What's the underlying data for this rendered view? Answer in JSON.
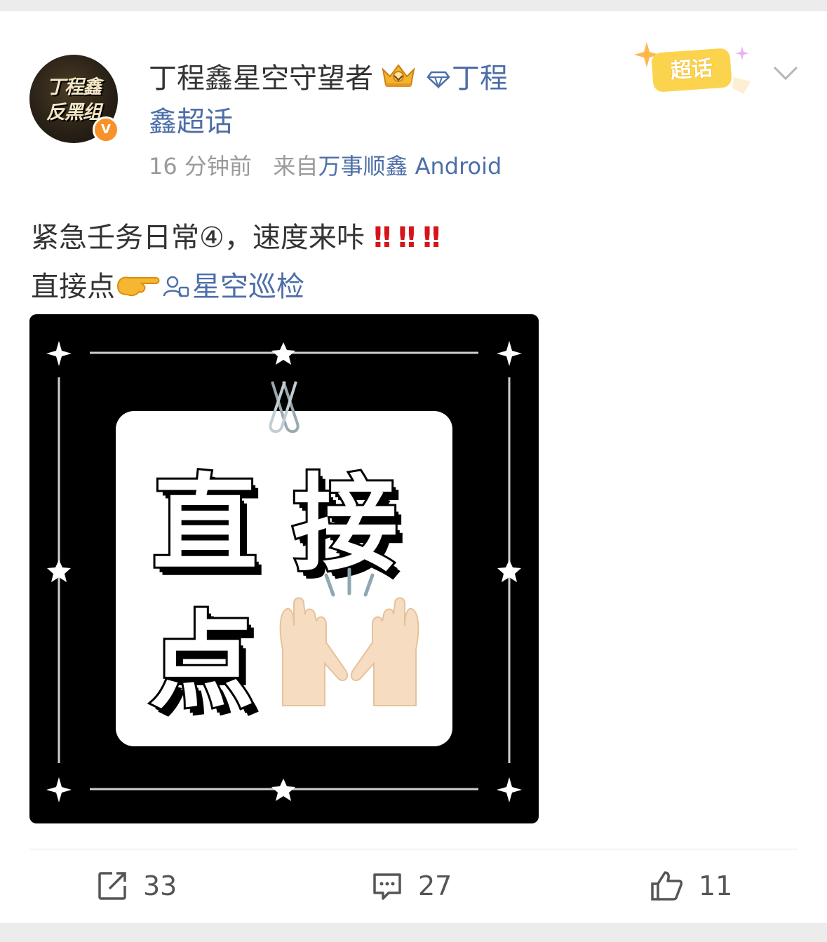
{
  "post": {
    "author": {
      "name": "丁程鑫星空守望者",
      "avatar_text_line1": "丁程鑫",
      "avatar_text_line2": "反黑组",
      "verified_mark": "V",
      "crown_icon": "crown-icon"
    },
    "topic_inline": {
      "icon": "diamond-icon",
      "text_line1": "丁程",
      "text_line2": "鑫超话"
    },
    "meta": {
      "time": "16 分钟前",
      "from_prefix": "来自",
      "source": "万事顺鑫 Android"
    },
    "badge": {
      "label": "超话"
    },
    "body": {
      "line1": "紧急壬务日常④，速度来咔",
      "exclamations": [
        "‼",
        "‼",
        "‼"
      ],
      "line2_prefix": "直接点",
      "line2_emoji": "pointing-right-icon",
      "link_icon": "super-topic-link-icon",
      "link_text": "星空巡检"
    },
    "image": {
      "char1": "直",
      "char2": "接",
      "char3": "点",
      "hands_icon": "raising-hands-icon",
      "paperclip_icon": "paperclip-icon"
    },
    "actions": {
      "repost_count": "33",
      "comment_count": "27",
      "like_count": "11"
    },
    "colors": {
      "link": "#4e6ea8",
      "exclamation": "#d7141a",
      "badge": "#fcd34d",
      "verify": "#f7922b"
    }
  }
}
